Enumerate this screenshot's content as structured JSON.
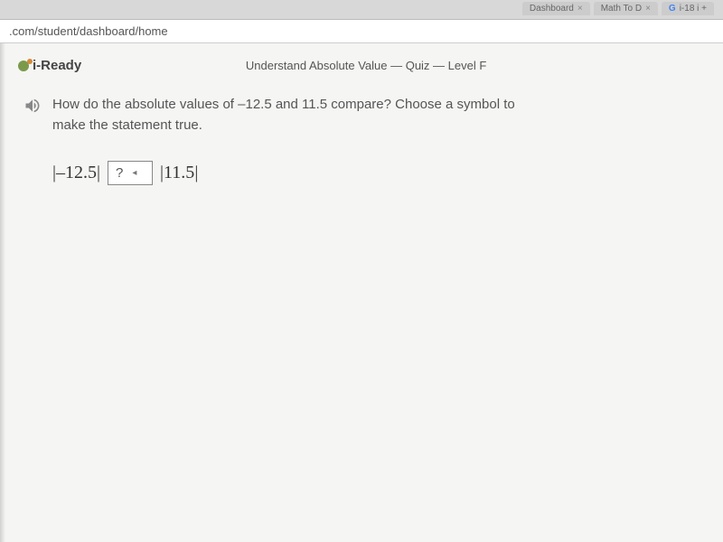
{
  "browser": {
    "tabs": [
      {
        "label": "Dashboard"
      },
      {
        "label": "Math To D"
      },
      {
        "label": "i-18 i +"
      }
    ],
    "url": ".com/student/dashboard/home"
  },
  "header": {
    "brand": "i-Ready",
    "lesson_title": "Understand Absolute Value — Quiz — Level F"
  },
  "question": {
    "prompt": "How do the absolute values of –12.5 and 11.5 compare? Choose a symbol to make the statement true.",
    "left_value": "–12.5",
    "right_value": "11.5",
    "dropdown_placeholder": "?"
  }
}
